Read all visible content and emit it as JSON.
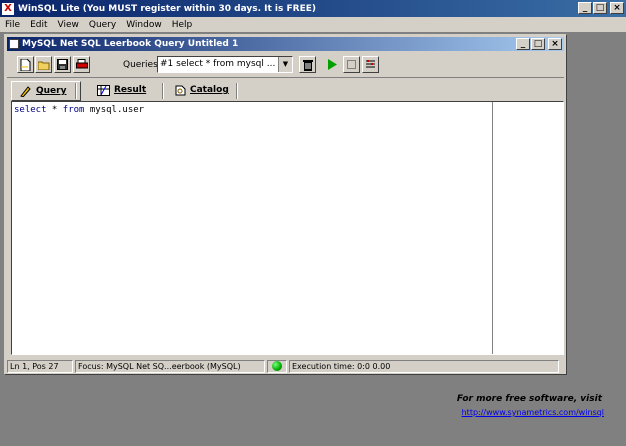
{
  "app": {
    "title": "WinSQL Lite (You MUST register within 30 days. It is FREE)"
  },
  "menu": {
    "items": [
      "File",
      "Edit",
      "View",
      "Query",
      "Window",
      "Help"
    ]
  },
  "child_window": {
    "title": "MySQL Net SQL Leerbook Query    Untitled 1"
  },
  "toolbar": {
    "queries_label": "Queries",
    "queries_value": "#1 select * from mysql ..."
  },
  "tabs": [
    {
      "label": "Query"
    },
    {
      "label": "Result"
    },
    {
      "label": "Catalog"
    }
  ],
  "editor": {
    "kw1": "select",
    "star": " * ",
    "kw2": "from",
    "rest": " mysql.user"
  },
  "status": {
    "position": "Ln 1, Pos 27",
    "focus": "Focus: MySQL Net SQ...eerbook (MySQL)",
    "exec_time": "Execution time: 0:0 0.00"
  },
  "footer": {
    "promo": "For more free software, visit",
    "link": "http://www.synametrics.com/winsql"
  }
}
